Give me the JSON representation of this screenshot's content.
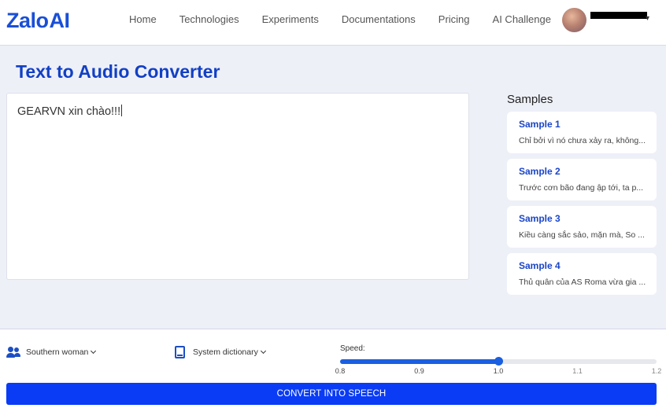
{
  "brand": {
    "logo_text": "Zalo",
    "logo_ai": "AI",
    "colors": {
      "primary": "#1a4fd6",
      "button": "#0a3cf5",
      "title": "#1240c4"
    }
  },
  "nav": {
    "items": [
      {
        "label": "Home"
      },
      {
        "label": "Technologies"
      },
      {
        "label": "Experiments"
      },
      {
        "label": "Documentations"
      },
      {
        "label": "Pricing"
      },
      {
        "label": "AI Challenge"
      }
    ]
  },
  "user": {
    "avatar_icon": "user-avatar",
    "menu_icon": "chevron-down-icon"
  },
  "page": {
    "title": "Text to Audio Converter"
  },
  "editor": {
    "value": "GEARVN xin chào!!!"
  },
  "samples": {
    "title": "Samples",
    "items": [
      {
        "name": "Sample 1",
        "snippet": "Chỉ bởi vì nó chưa xảy ra, không..."
      },
      {
        "name": "Sample 2",
        "snippet": "Trước cơn bão đang ập tới, ta p..."
      },
      {
        "name": "Sample 3",
        "snippet": "Kiều càng sắc sảo, mặn mà, So ..."
      },
      {
        "name": "Sample 4",
        "snippet": "Thủ quân của AS Roma vừa gia ..."
      }
    ]
  },
  "controls": {
    "voice": {
      "label": "Southern woman",
      "icon": "users-icon"
    },
    "dictionary": {
      "label": "System dictionary",
      "icon": "book-icon"
    },
    "speed": {
      "label": "Speed:",
      "value": 1.0,
      "min": 0.8,
      "max": 1.2,
      "ticks": [
        "0.8",
        "0.9",
        "1.0",
        "1.1",
        "1.2"
      ]
    },
    "convert_label": "CONVERT INTO SPEECH"
  }
}
